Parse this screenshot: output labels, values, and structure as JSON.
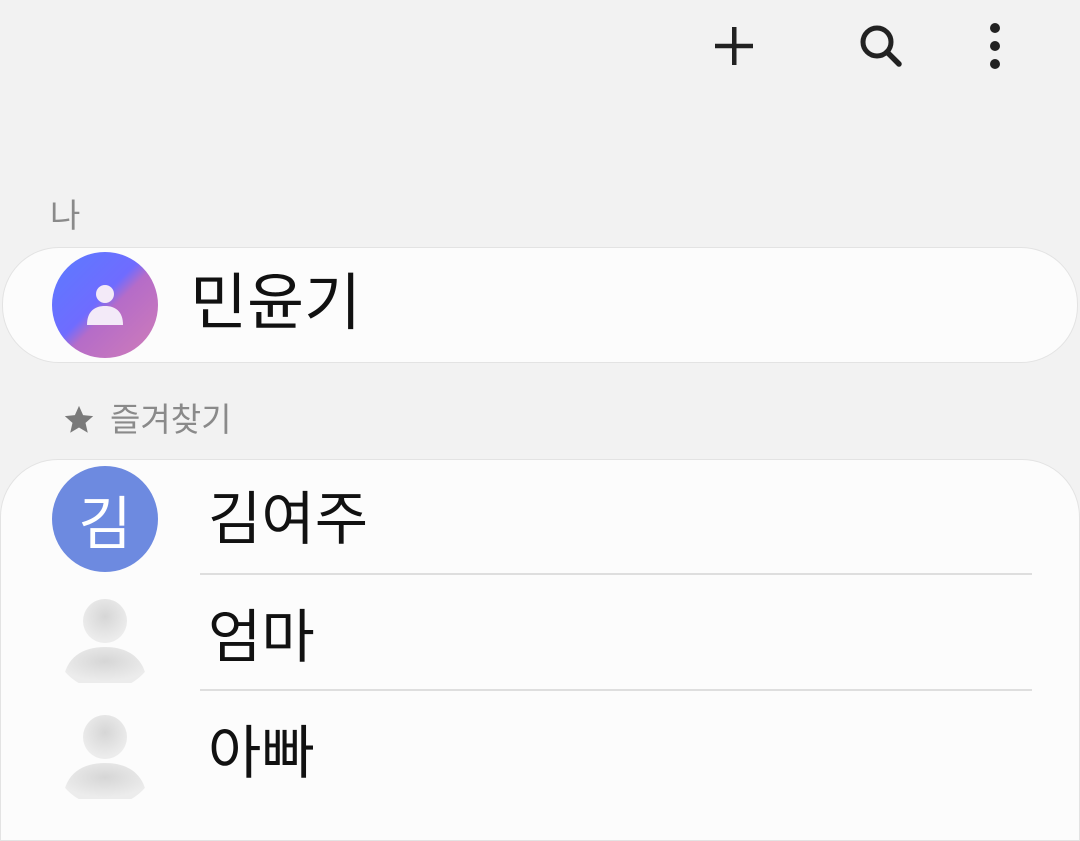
{
  "toolbar": {
    "add_icon": "plus-icon",
    "search_icon": "search-icon",
    "more_icon": "more-vertical-icon"
  },
  "sections": {
    "me_label": "나",
    "favorites_label": "즐겨찾기",
    "favorites_icon": "star-icon"
  },
  "me": {
    "name": "민윤기",
    "avatar_icon": "person-icon"
  },
  "favorites": [
    {
      "name": "김여주",
      "avatar_text": "김",
      "avatar_color": "#6d8ae0"
    },
    {
      "name": "엄마",
      "avatar_icon": "person-placeholder-icon"
    },
    {
      "name": "아빠",
      "avatar_icon": "person-placeholder-icon"
    }
  ],
  "colors": {
    "background": "#f2f2f2",
    "card": "#fcfcfc",
    "section_label": "#8a8a8a",
    "text": "#111111"
  }
}
